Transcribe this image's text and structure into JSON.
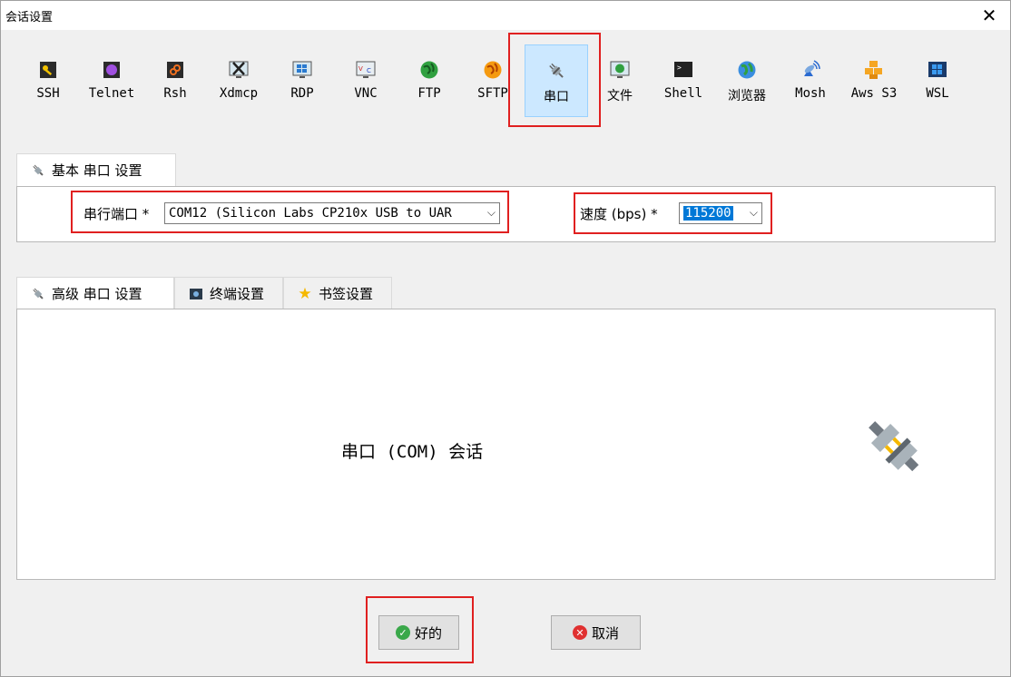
{
  "window": {
    "title": "会话设置",
    "close_label": "✕"
  },
  "protocols": [
    {
      "label": "SSH",
      "icon": "key-icon"
    },
    {
      "label": "Telnet",
      "icon": "telnet-icon"
    },
    {
      "label": "Rsh",
      "icon": "rsh-icon"
    },
    {
      "label": "Xdmcp",
      "icon": "xdmcp-icon"
    },
    {
      "label": "RDP",
      "icon": "rdp-icon"
    },
    {
      "label": "VNC",
      "icon": "vnc-icon"
    },
    {
      "label": "FTP",
      "icon": "ftp-globe-icon"
    },
    {
      "label": "SFTP",
      "icon": "sftp-globe-icon"
    },
    {
      "label": "串口",
      "icon": "serial-plug-icon",
      "selected": true
    },
    {
      "label": "文件",
      "icon": "file-monitor-icon"
    },
    {
      "label": "Shell",
      "icon": "shell-terminal-icon"
    },
    {
      "label": "浏览器",
      "icon": "browser-globe-icon"
    },
    {
      "label": "Mosh",
      "icon": "mosh-satellite-icon"
    },
    {
      "label": "Aws S3",
      "icon": "aws-cubes-icon"
    },
    {
      "label": "WSL",
      "icon": "windows-icon"
    }
  ],
  "basic_tab": {
    "label": "基本 串口 设置"
  },
  "basic": {
    "port_label": "串行端口 *",
    "port_value": "COM12  (Silicon Labs CP210x USB to UAR",
    "speed_label": "速度 (bps) *",
    "speed_value": "115200"
  },
  "adv_tabs": [
    {
      "label": "高级 串口 设置",
      "icon": "plug-icon"
    },
    {
      "label": "终端设置",
      "icon": "terminal-icon"
    },
    {
      "label": "书签设置",
      "icon": "star-icon"
    }
  ],
  "main": {
    "center_text": "串口 (COM) 会话"
  },
  "buttons": {
    "ok": "好的",
    "cancel": "取消"
  },
  "colors": {
    "accent_red": "#e02020",
    "selected_bg": "#cce8ff",
    "select_highlight": "#0078d7"
  }
}
